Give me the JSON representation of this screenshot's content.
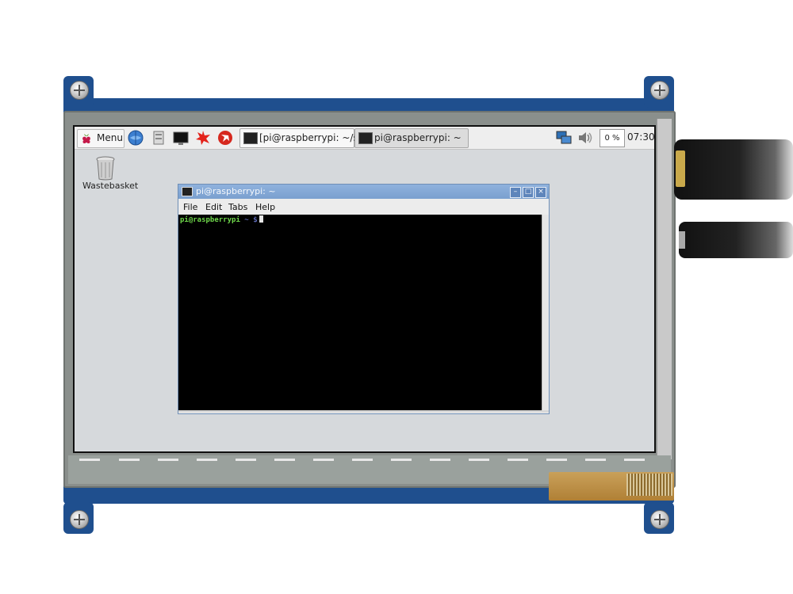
{
  "taskbar": {
    "menu_label": "Menu",
    "tasks": [
      {
        "label": "[pi@raspberrypi: ~/sa..."
      },
      {
        "label": "pi@raspberrypi: ~"
      }
    ],
    "cpu_label": "0 %",
    "clock": "07:30"
  },
  "desktop": {
    "icons": [
      {
        "label": "Wastebasket"
      }
    ]
  },
  "terminal": {
    "title": "pi@raspberrypi: ~",
    "menu": [
      "File",
      "Edit",
      "Tabs",
      "Help"
    ],
    "prompt_user": "pi@raspberrypi",
    "prompt_rest": "~ $"
  },
  "colors": {
    "pcb": "#1f4f8e",
    "desktop_bg": "#d6d9dc",
    "titlebar": "#7aa0cf",
    "prompt_user": "#6fd84b",
    "prompt_path": "#7b8cf0"
  },
  "icons": {
    "menu": "raspberry-icon",
    "quick_launch": [
      "web-browser-icon",
      "file-manager-icon",
      "terminal-icon",
      "mathematica-icon",
      "wolfram-icon"
    ],
    "tray": [
      "network-icon",
      "volume-icon"
    ],
    "desktop": [
      "trash-icon"
    ]
  }
}
